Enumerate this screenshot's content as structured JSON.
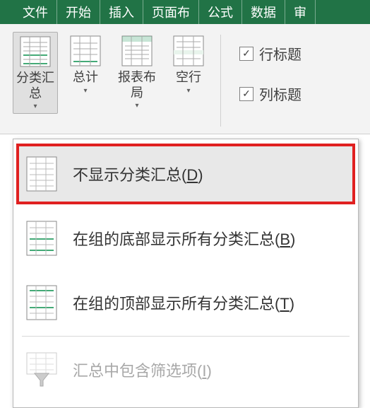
{
  "tabs": {
    "file": "文件",
    "home": "开始",
    "insert": "插入",
    "pagelayout": "页面布",
    "formulas": "公式",
    "data": "数据",
    "review": "审"
  },
  "ribbon": {
    "subtotal": "分类汇总",
    "grand": "总计",
    "layout": "报表布局",
    "blank": "空行",
    "rowheaders": "行标题",
    "colheaders": "列标题"
  },
  "menu": {
    "noSubtotal": "不显示分类汇总(",
    "noSubtotalKey": "D",
    "bottom": "在组的底部显示所有分类汇总(",
    "bottomKey": "B",
    "top": "在组的顶部显示所有分类汇总(",
    "topKey": "T",
    "filtered": "汇总中包含筛选项(",
    "filteredKey": "I",
    "close": ")"
  }
}
